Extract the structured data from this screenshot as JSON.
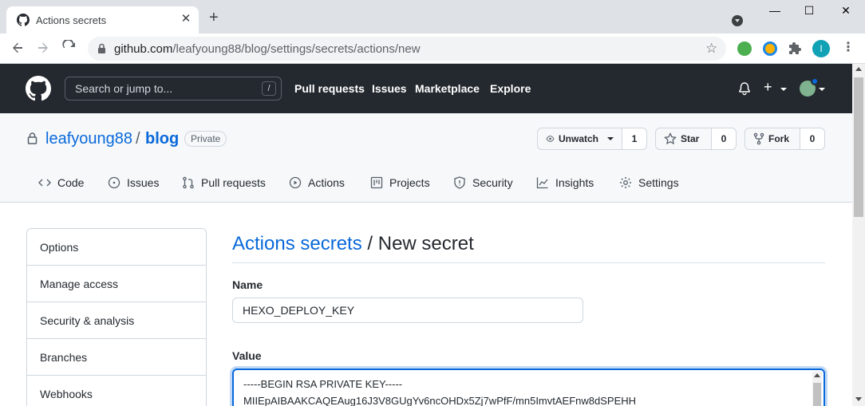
{
  "browser": {
    "tab_title": "Actions secrets",
    "tab_close": "✕",
    "new_tab": "+",
    "url_host": "github.com",
    "url_path": "/leafyoung88/blog/settings/secrets/actions/new",
    "profile_initial": "I",
    "window_controls": {
      "minimize": "—",
      "maximize": "☐",
      "close": "✕"
    }
  },
  "github": {
    "search_placeholder": "Search or jump to...",
    "search_shortcut": "/",
    "nav": [
      "Pull requests",
      "Issues",
      "Marketplace",
      "Explore"
    ],
    "plus": "+"
  },
  "repo": {
    "owner": "leafyoung88",
    "separator": "/",
    "name": "blog",
    "visibility": "Private",
    "watch": {
      "label": "Unwatch",
      "count": "1"
    },
    "star": {
      "label": "Star",
      "count": "0"
    },
    "fork": {
      "label": "Fork",
      "count": "0"
    },
    "tabs": [
      "Code",
      "Issues",
      "Pull requests",
      "Actions",
      "Projects",
      "Security",
      "Insights",
      "Settings"
    ]
  },
  "sidebar": {
    "items": [
      "Options",
      "Manage access",
      "Security & analysis",
      "Branches",
      "Webhooks"
    ]
  },
  "form": {
    "breadcrumb_link": "Actions secrets",
    "breadcrumb_sep": " / ",
    "title": "New secret",
    "name_label": "Name",
    "name_value": "HEXO_DEPLOY_KEY",
    "value_label": "Value",
    "value_lines": [
      "-----BEGIN RSA PRIVATE KEY-----",
      "MIIEpAIBAAKCAQEAug16J3V8GUgYv6ncOHDx5Zj7wPfF/mn5ImvtAEFnw8dSPEHH"
    ]
  },
  "colors": {
    "header_bg": "#24292f",
    "link": "#0969da",
    "focus": "#0969da"
  }
}
